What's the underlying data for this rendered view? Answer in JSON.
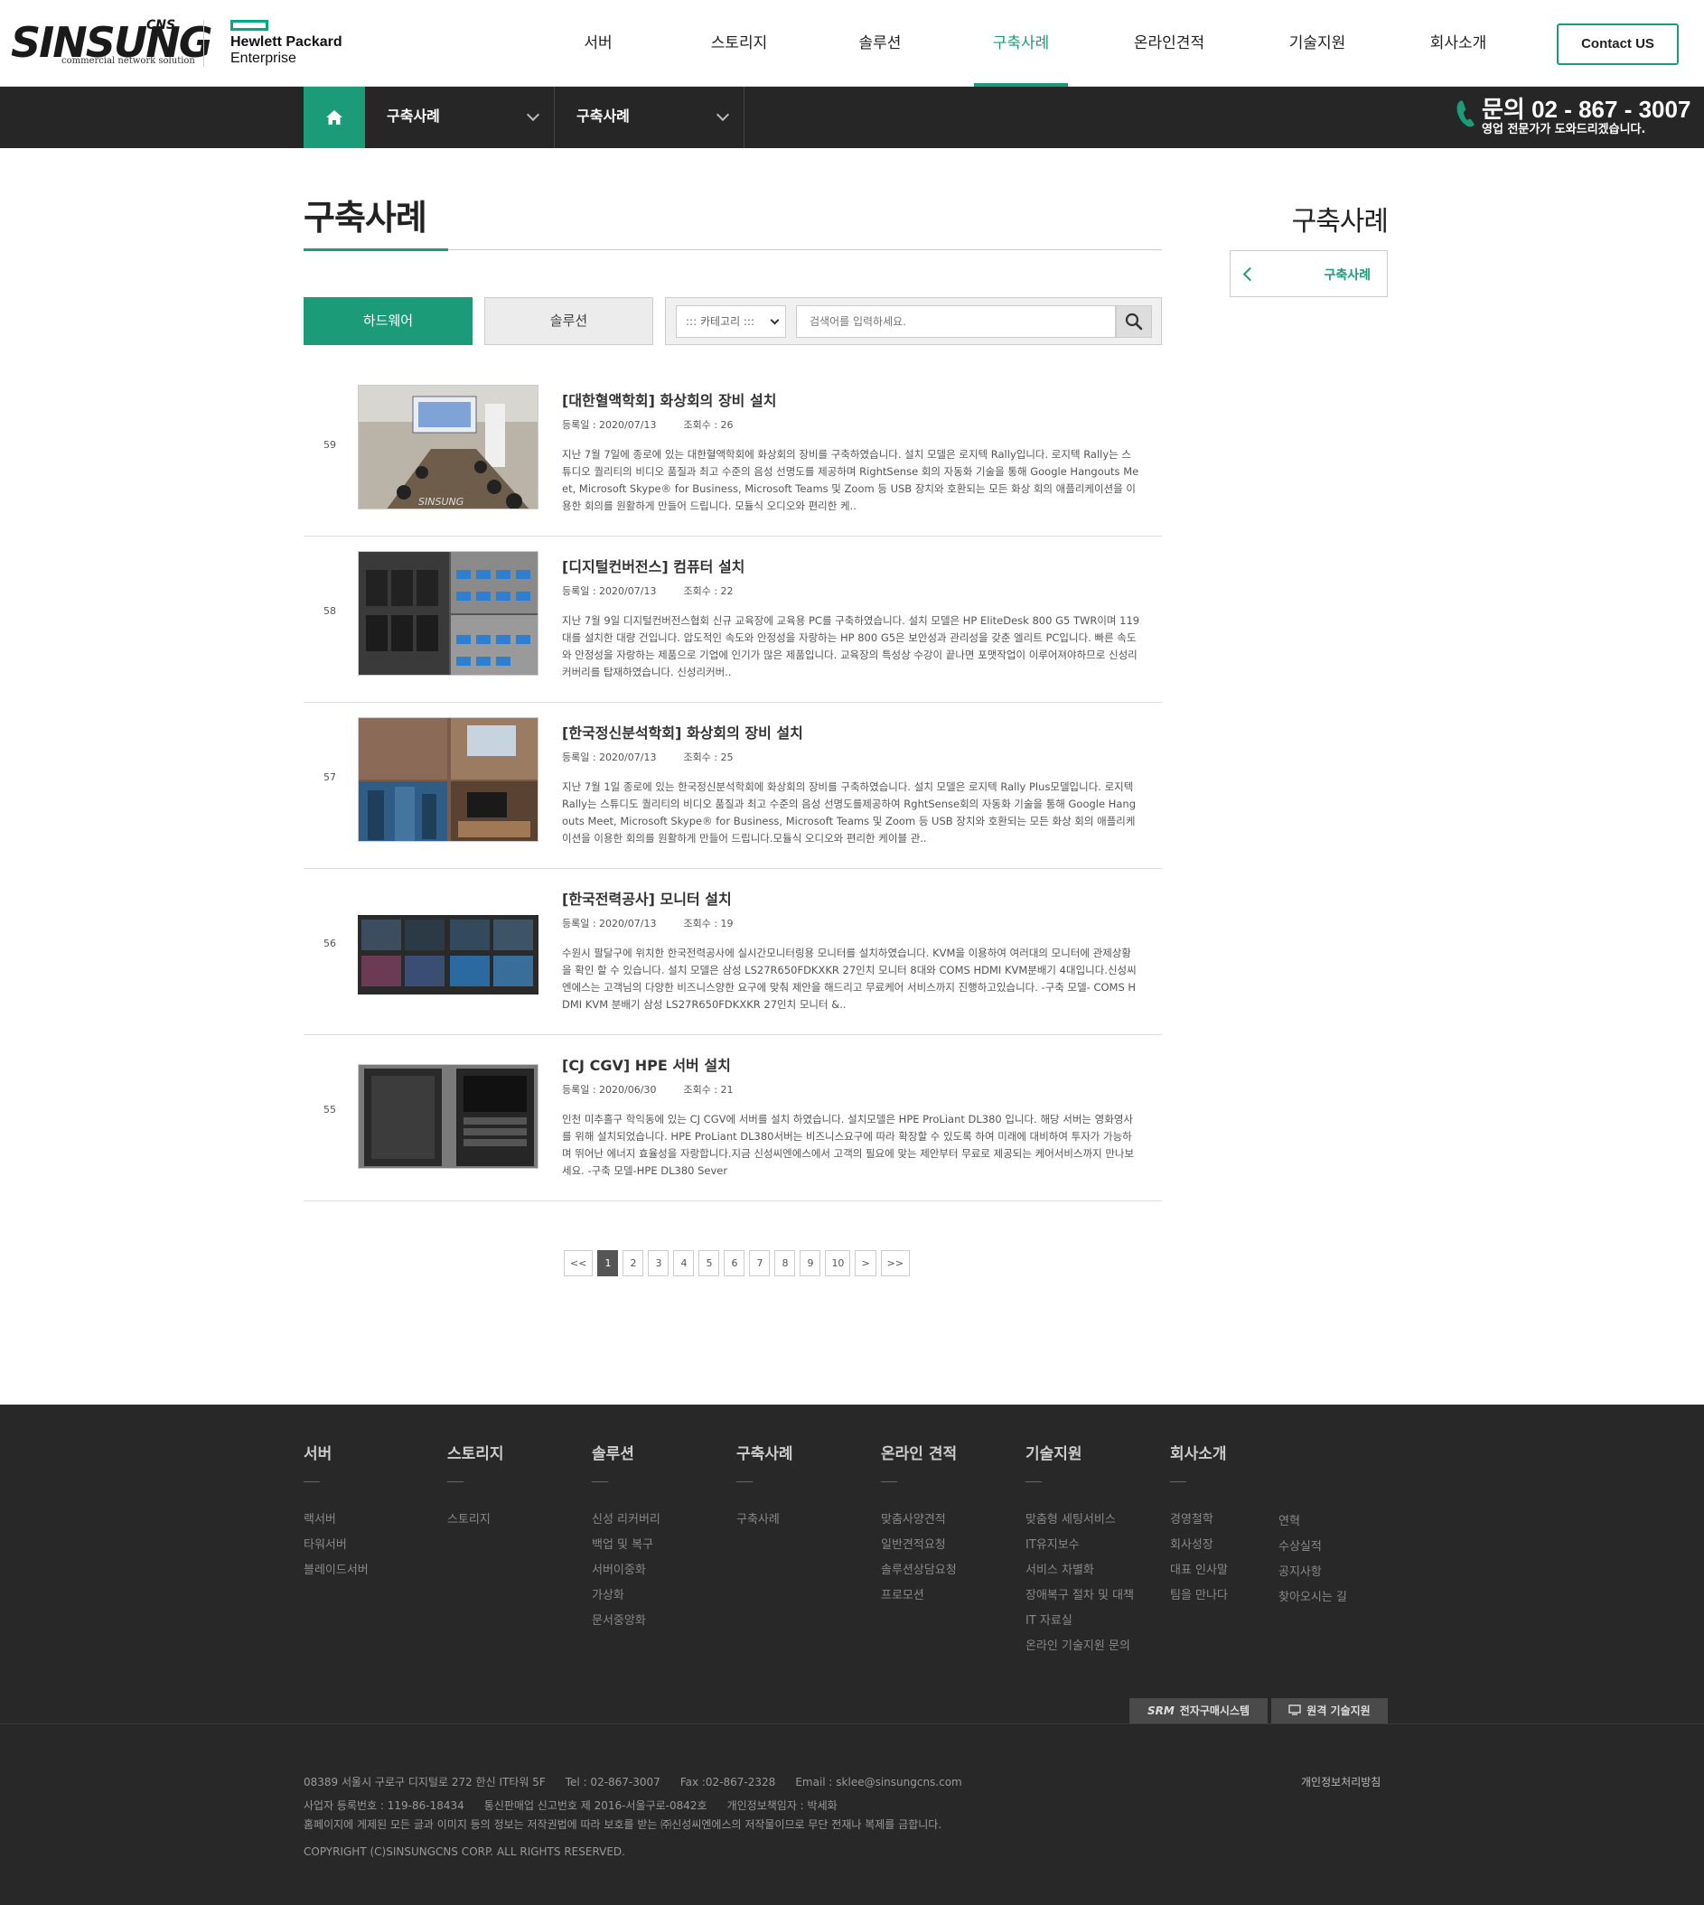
{
  "header": {
    "logo_brand": "SINSUNG",
    "logo_cns": "CNS",
    "logo_tagline": "commercial network solution",
    "partner_line1": "Hewlett Packard",
    "partner_line2": "Enterprise",
    "nav": [
      "서버",
      "스토리지",
      "솔루션",
      "구축사례",
      "온라인견적",
      "기술지원",
      "회사소개"
    ],
    "active_nav": "구축사례",
    "contact_label": "Contact US"
  },
  "subbar": {
    "crumb1": "구축사례",
    "crumb2": "구축사례",
    "phone": "문의 02 - 867 - 3007",
    "phone_sub": "영업 전문가가 도와드리겠습니다."
  },
  "content": {
    "page_title": "구축사례",
    "side_title": "구축사례",
    "side_item": "구축사례",
    "tab_hardware": "하드웨어",
    "tab_solution": "솔루션",
    "category_select": "::: 카테고리 :::",
    "search_placeholder": "검색어를 입력하세요."
  },
  "posts": [
    {
      "num": "59",
      "title": "[대한혈액학회] 화상회의 장비 설치",
      "date": "등록일 : 2020/07/13",
      "views": "조회수 : 26",
      "desc": "지난 7월 7일에 종로에 있는 대한혈액학회에 화상회의 장비를 구축하였습니다. 설치 모델은 로지텍 Rally입니다. 로지텍 Rally는 스튜디오 퀄리티의 비디오 품질과 최고 수준의 음성 선명도를 제공하며 RightSense 회의 자동화 기술을 통해 Google Hangouts Meet, Microsoft Skype® for Business, Microsoft Teams 및 Zoom 등 USB 장치와 호환되는 모든 화상 회의 애플리케이션을 이용한 회의를 원활하게 만들어 드립니다. 모듈식 오디오와 편리한 케.."
    },
    {
      "num": "58",
      "title": "[디지털컨버전스] 컴퓨터 설치",
      "date": "등록일 : 2020/07/13",
      "views": "조회수 : 22",
      "desc": "지난 7월 9일 디지털컨버전스협회 신규 교육장에 교육용 PC를 구축하였습니다. 설치 모델은 HP EliteDesk 800 G5 TWR이며 119대를 설치한 대량 건입니다. 압도적인 속도와 안정성을 자랑하는 HP 800 G5은 보안성과 관리성을 갖춘 엘리트 PC입니다. 빠른 속도와 안정성을 자랑하는 제품으로 기업에 인기가 많은 제품입니다. 교육장의 특성상 수강이 끝나면 포맷작업이 이루어져야하므로 신성리커버리를 탑재하였습니다. 신성리커버.."
    },
    {
      "num": "57",
      "title": "[한국정신분석학회] 화상회의 장비 설치",
      "date": "등록일 : 2020/07/13",
      "views": "조회수 : 25",
      "desc": "지난 7월 1일 종로에 있는 한국정신분석학회에 화상회의 장비를 구축하였습니다. 설치 모델은 로지텍 Rally Plus모델입니다. 로지텍 Rally는 스튜디도 퀄리티의 비디오 품질과 최고 수준의 음성 선명도를제공하여 RghtSense회의 자동화 기술을 통해 Google Hangouts Meet, Microsoft Skype® for Business, Microsoft Teams 및 Zoom 등 USB 장치와 호환되는 모든 화상 회의 애플리케이션을 이용한 회의를 원활하게 만들어 드립니다.모듈식 오디오와 편리한 케이블 관.."
    },
    {
      "num": "56",
      "title": "[한국전력공사] 모니터 설치",
      "date": "등록일 : 2020/07/13",
      "views": "조회수 : 19",
      "desc": "수원시 팔달구에 위치한 한국전력공사에 실시간모니터링용 모니터를 설치하였습니다. KVM을 이용하여 여러대의 모니터에 관제상황을 확인 할 수 있습니다. 설치 모델은 삼성 LS27R650FDKXKR 27인치 모니터 8대와 COMS HDMI KVM분배기 4대입니다.신성씨엔에스는 고객님의 다양한 비즈니스양한 요구에 맞춰 제안을 해드리고 무료케어 서비스까지 진행하고있습니다. -구축 모델- COMS HDMI KVM 분배기 삼성 LS27R650FDKXKR 27인치 모니터 &.."
    },
    {
      "num": "55",
      "title": "[CJ CGV] HPE 서버 설치",
      "date": "등록일 : 2020/06/30",
      "views": "조회수 : 21",
      "desc": "인천 미추홀구 학익동에 있는 CJ CGV에 서버를 설치 하였습니다. 설치모델은 HPE ProLiant DL380 입니다. 해당 서버는 영화영사를 위해 설치되었습니다. HPE ProLiant DL380서버는 비즈니스요구에 따라 확장할 수 있도록 하여 미래에 대비하여 투자가 가능하며 뛰어난 에너지 효율성을 자랑합니다.지금 신성씨엔에스에서 고객의 필요에 맞는 제안부터 무료로 제공되는 케어서비스까지 만나보세요. -구축 모델-HPE DL380 Sever"
    }
  ],
  "pagination": [
    "<<",
    "1",
    "2",
    "3",
    "4",
    "5",
    "6",
    "7",
    "8",
    "9",
    "10",
    ">",
    ">>"
  ],
  "pagination_current": "1",
  "footer": {
    "columns": [
      {
        "title": "서버",
        "links": [
          "랙서버",
          "타워서버",
          "블레이드서버"
        ]
      },
      {
        "title": "스토리지",
        "links": [
          "스토리지"
        ]
      },
      {
        "title": "솔루션",
        "links": [
          "신성 리커버리",
          "백업 및 복구",
          "서버이중화",
          "가상화",
          "문서중앙화"
        ]
      },
      {
        "title": "구축사례",
        "links": [
          "구축사례"
        ]
      },
      {
        "title": "온라인 견적",
        "links": [
          "맞춤사양견적",
          "일반견적요청",
          "솔루션상담요청",
          "프로모션"
        ]
      },
      {
        "title": "기술지원",
        "links": [
          "맞춤형 세팅서비스",
          "IT유지보수",
          "서비스 차별화",
          "장애복구 절차 및 대책",
          "IT 자료실",
          "온라인 기술지원 문의"
        ]
      },
      {
        "title": "회사소개",
        "links": [
          "경영철학",
          "회사성장",
          "대표 인사말",
          "팀을 만나다"
        ]
      }
    ],
    "extra_links": [
      "연혁",
      "수상실적",
      "공지사항",
      "찾아오시는 길"
    ],
    "btn_srm": "전자구매시스템",
    "btn_srm_logo": "SRM",
    "btn_remote": "원격 기술지원",
    "address": "08389 서울시 구로구 디지털로 272 한신 IT타워 5F",
    "tel": "Tel : 02-867-3007",
    "fax": "Fax :02-867-2328",
    "email": "Email : sklee@sinsungcns.com",
    "biz_no": "사업자 등록번호 : 119-86-18434",
    "mail_order": "통신판매업 신고번호 제 2016-서울구로-0842호",
    "privacy_officer": "개인정보책임자 : 박세화",
    "copyright_notice": "홈페이지에 게제된 모든 글과 이미지 등의 정보는 저작권법에 따라 보호를 받는 ㈜신성씨엔에스의 저작물이므로 무단 전재나 복제를 금합니다.",
    "copyright": "COPYRIGHT (C)SINSUNGCNS CORP. ALL RIGHTS RESERVED.",
    "privacy_policy": "개인정보처리방침"
  },
  "colors": {
    "accent": "#1b9b78",
    "dark_bar": "#262626",
    "footer_bg": "#282828"
  }
}
